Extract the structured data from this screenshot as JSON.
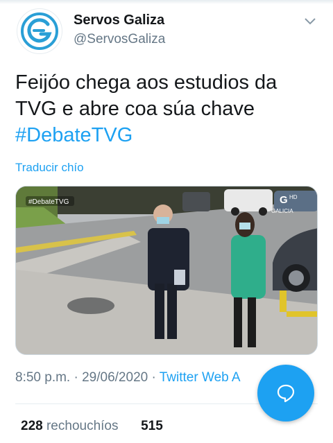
{
  "account": {
    "name": "Servos Galiza",
    "handle": "@ServosGaliza"
  },
  "tweet": {
    "text": "Feijóo chega aos estudios da TVG e abre coa súa chave",
    "hashtag": "#DebateTVG",
    "translate_label": "Traducir chío"
  },
  "media": {
    "overlay_hashtag": "#DebateTVG",
    "channel_logo_text": "GALICIA",
    "channel_hd": "HD"
  },
  "meta": {
    "time": "8:50 p.m.",
    "separator": "·",
    "date": "29/06/2020",
    "source": "Twitter Web A"
  },
  "stats": {
    "retweets_count": "228",
    "retweets_label": "rechouchíos",
    "likes_count": "515"
  },
  "icons": {
    "caret": "chevron-down-icon",
    "compose": "chat-bubble-icon",
    "avatar_logo": "servos-galiza-logo"
  },
  "colors": {
    "accent": "#1da1f2",
    "muted": "#657786",
    "text": "#14171a"
  }
}
